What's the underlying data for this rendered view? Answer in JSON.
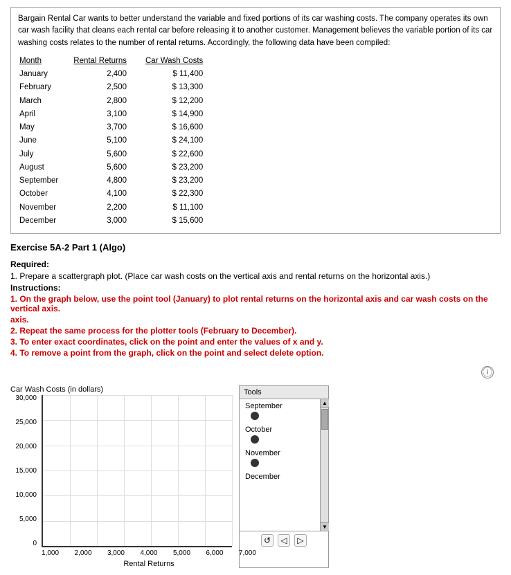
{
  "intro": {
    "text": "Bargain Rental Car wants to better understand the variable and fixed portions of its car washing costs. The company operates its own car wash facility that cleans each rental car before releasing it to another customer. Management believes the variable portion of its car washing costs relates to the number of rental returns. Accordingly, the following data have been compiled:"
  },
  "table": {
    "headers": [
      "Month",
      "Rental Returns",
      "Car Wash Costs"
    ],
    "rows": [
      [
        "January",
        "2,400",
        "$ 11,400"
      ],
      [
        "February",
        "2,500",
        "$ 13,300"
      ],
      [
        "March",
        "2,800",
        "$ 12,200"
      ],
      [
        "April",
        "3,100",
        "$ 14,900"
      ],
      [
        "May",
        "3,700",
        "$ 16,600"
      ],
      [
        "June",
        "5,100",
        "$ 24,100"
      ],
      [
        "July",
        "5,600",
        "$ 22,600"
      ],
      [
        "August",
        "5,600",
        "$ 23,200"
      ],
      [
        "September",
        "4,800",
        "$ 23,200"
      ],
      [
        "October",
        "4,100",
        "$ 22,300"
      ],
      [
        "November",
        "2,200",
        "$ 11,100"
      ],
      [
        "December",
        "3,000",
        "$ 15,600"
      ]
    ]
  },
  "exercise": {
    "title": "Exercise 5A-2 Part 1 (Algo)",
    "required_label": "Required:",
    "instruction_1": "1. Prepare a scattergraph plot. (Place car wash costs on the vertical axis and rental returns on the horizontal axis.)",
    "instructions_label": "Instructions:",
    "step1": "1. On the graph below, use the point tool (January) to plot rental returns on the horizontal axis and car wash costs on the vertical axis.",
    "step1b": "axis.",
    "step2": "2. Repeat the same process for the plotter tools (February to December).",
    "step3": "3. To enter exact coordinates, click on the point and enter the values of x and y.",
    "step4": "4. To remove a point from the graph, click on the point and select delete option."
  },
  "chart": {
    "title": "Car Wash Costs (in dollars)",
    "y_labels": [
      "30,000",
      "25,000",
      "20,000",
      "15,000",
      "10,000",
      "5,000",
      "0"
    ],
    "x_labels": [
      "1,000",
      "2,000",
      "3,000",
      "4,000",
      "5,000",
      "6,000",
      "7,000"
    ],
    "x_title": "Rental Returns"
  },
  "tools": {
    "header": "Tools",
    "items": [
      {
        "label": "September",
        "has_dot": true
      },
      {
        "label": "October",
        "has_dot": true
      },
      {
        "label": "November",
        "has_dot": true
      },
      {
        "label": "December",
        "has_dot": false
      }
    ],
    "scroll_up_label": "▲",
    "scroll_down_label": "▼",
    "footer_icons": [
      "↺",
      "◁",
      "▷"
    ]
  }
}
